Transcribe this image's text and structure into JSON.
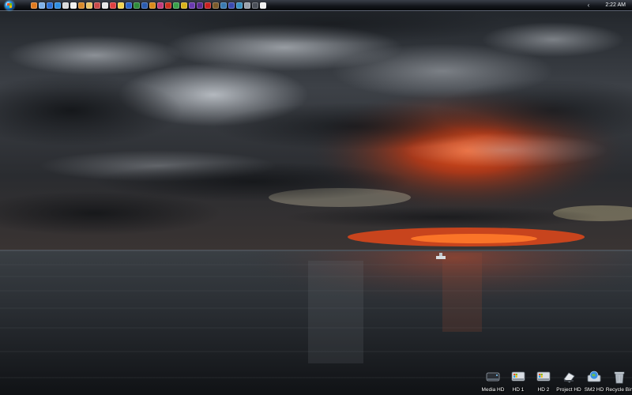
{
  "taskbar": {
    "clock": "2:22 AM",
    "tray_chevron": "‹",
    "quick_launch": [
      {
        "name": "firefox-icon",
        "color": "#e07a1f"
      },
      {
        "name": "bird-icon",
        "color": "#7fb0e8"
      },
      {
        "name": "globe-icon",
        "color": "#2b6fd6"
      },
      {
        "name": "ie-icon",
        "color": "#2f8ee0"
      },
      {
        "name": "chrome-icon",
        "color": "#d9d9d9"
      },
      {
        "name": "music-icon",
        "color": "#f0f0f0"
      },
      {
        "name": "folder-icon",
        "color": "#d98a2a"
      },
      {
        "name": "mail-icon",
        "color": "#e9c46a"
      },
      {
        "name": "calendar-icon",
        "color": "#c94a4a"
      },
      {
        "name": "shopping-icon",
        "color": "#e6e6e6"
      },
      {
        "name": "paint-icon",
        "color": "#e04040"
      },
      {
        "name": "note-icon",
        "color": "#f2d34f"
      },
      {
        "name": "word-icon",
        "color": "#2a63c9"
      },
      {
        "name": "excel-icon",
        "color": "#2e8b3a"
      },
      {
        "name": "photoshop-icon",
        "color": "#2a5bb0"
      },
      {
        "name": "illustrator-icon",
        "color": "#d98a1a"
      },
      {
        "name": "indesign-icon",
        "color": "#c23a7a"
      },
      {
        "name": "flash-icon",
        "color": "#c9301e"
      },
      {
        "name": "dreamweaver-icon",
        "color": "#3aa04a"
      },
      {
        "name": "fireworks-icon",
        "color": "#d9b21a"
      },
      {
        "name": "premiere-icon",
        "color": "#6a3ab0"
      },
      {
        "name": "aftereffects-icon",
        "color": "#5a2a90"
      },
      {
        "name": "acrobat-icon",
        "color": "#c82020"
      },
      {
        "name": "bridge-icon",
        "color": "#7a5a2a"
      },
      {
        "name": "soundbooth-icon",
        "color": "#3a7ab0"
      },
      {
        "name": "encore-icon",
        "color": "#3a4ab0"
      },
      {
        "name": "contribute-icon",
        "color": "#3a90c0"
      },
      {
        "name": "settings-icon",
        "color": "#9aa0aa"
      },
      {
        "name": "terminal-icon",
        "color": "#4a4f58"
      },
      {
        "name": "notepad-icon",
        "color": "#f0f0f0"
      }
    ]
  },
  "desktop_icons": [
    {
      "name": "media-hd-icon",
      "label": "Media HD",
      "kind": "drive-dark"
    },
    {
      "name": "hd1-icon",
      "label": "HD 1",
      "kind": "drive-win"
    },
    {
      "name": "hd2-icon",
      "label": "HD 2",
      "kind": "drive-win"
    },
    {
      "name": "project-hd-icon",
      "label": "Project HD",
      "kind": "drive-usb"
    },
    {
      "name": "sm2-hd-icon",
      "label": "SM2 HD",
      "kind": "drive-globe"
    },
    {
      "name": "recycle-bin-icon",
      "label": "Recycle Bin",
      "kind": "bin"
    }
  ]
}
